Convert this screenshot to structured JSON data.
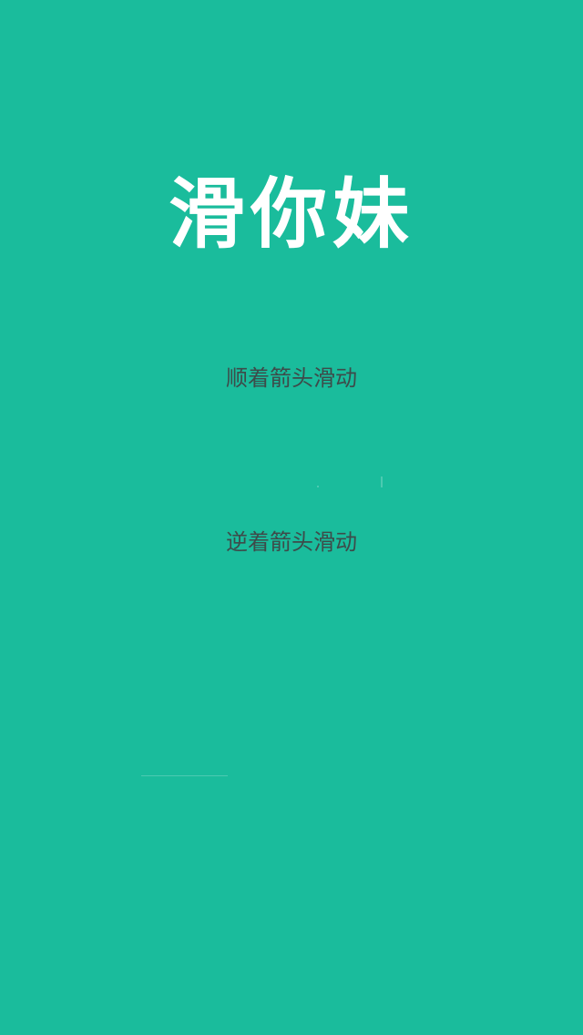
{
  "app": {
    "title": "滑你妹",
    "background_color": "#1abc9c"
  },
  "instructions": {
    "forward": "顺着箭头滑动",
    "backward": "逆着箭头滑动"
  }
}
